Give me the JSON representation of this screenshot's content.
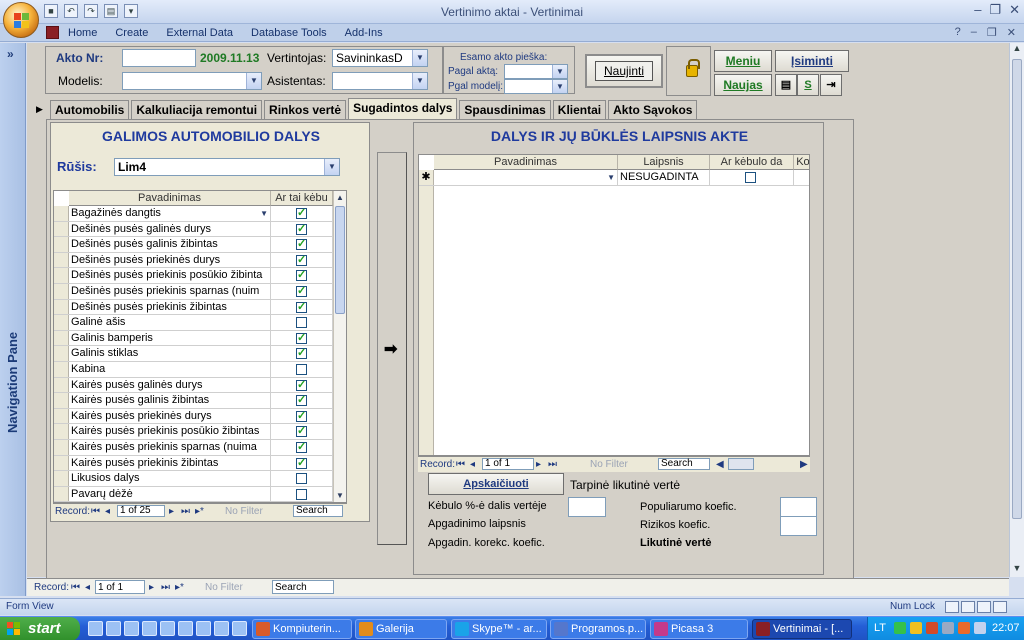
{
  "window": {
    "title": "Vertinimo aktai - Vertinimai",
    "qat_icons": [
      "save-icon",
      "undo-icon",
      "redo-icon",
      "view-icon",
      "customize-icon"
    ]
  },
  "ribbon": {
    "tabs": [
      "Home",
      "Create",
      "External Data",
      "Database Tools",
      "Add-Ins"
    ]
  },
  "nav_pane": {
    "label": "Navigation Pane",
    "toggle": "»"
  },
  "header": {
    "akto_nr_label": "Akto Nr:",
    "akto_nr_value": "",
    "date": "2009.11.13",
    "vertintojas_label": "Vertintojas:",
    "vertintojas_value": "SavininkasD",
    "modelis_label": "Modelis:",
    "modelis_value": "",
    "asistentas_label": "Asistentas:",
    "asistentas_value": ""
  },
  "search_panel": {
    "caption": "Esamo akto pieška:",
    "by_act_label": "Pagal aktą:",
    "by_model_label": "Pgal modelį:"
  },
  "buttons": {
    "refresh": "Naujinti",
    "menu": "Meniu",
    "save": "Įsiminti",
    "new": "Naujas",
    "s_button": "S",
    "calculate": "Apskaičiuoti"
  },
  "tabs": [
    "Automobilis",
    "Kalkuliacija remontui",
    "Rinkos vertė",
    "Sugadintos dalys",
    "Spausdinimas",
    "Klientai",
    "Akto Sąvokos"
  ],
  "active_tab": "Sugadintos dalys",
  "left_panel": {
    "title": "GALIMOS AUTOMOBILIO DALYS",
    "rusis_label": "Rūšis:",
    "rusis_value": "Lim4",
    "columns": [
      "Pavadinimas",
      "Ar tai kėbu"
    ],
    "rows": [
      {
        "name": "Bagažinės dangtis",
        "checked": true
      },
      {
        "name": "Dešinės pusės galinės durys",
        "checked": true
      },
      {
        "name": "Dešinės pusės galinis žibintas",
        "checked": true
      },
      {
        "name": "Dešinės pusės priekinės durys",
        "checked": true
      },
      {
        "name": "Dešinės pusės priekinis posūkio žibinta",
        "checked": true
      },
      {
        "name": "Dešinės pusės priekinis sparnas (nuim",
        "checked": true
      },
      {
        "name": "Dešinės pusės priekinis žibintas",
        "checked": true
      },
      {
        "name": "Galinė ašis",
        "checked": false
      },
      {
        "name": "Galinis bamperis",
        "checked": true
      },
      {
        "name": "Galinis stiklas",
        "checked": true
      },
      {
        "name": "Kabina",
        "checked": false
      },
      {
        "name": "Kairės pusės galinės durys",
        "checked": true
      },
      {
        "name": "Kairės pusės galinis žibintas",
        "checked": true
      },
      {
        "name": "Kairės pusės priekinės durys",
        "checked": true
      },
      {
        "name": "Kairės pusės priekinis posūkio žibintas",
        "checked": true
      },
      {
        "name": "Kairės pusės priekinis sparnas (nuima",
        "checked": true
      },
      {
        "name": "Kairės pusės priekinis žibintas",
        "checked": true
      },
      {
        "name": "Likusios dalys",
        "checked": false
      },
      {
        "name": "Pavarų dėžė",
        "checked": false
      }
    ],
    "record_nav": {
      "label": "Record:",
      "value": "1 of 25",
      "filter": "No Filter",
      "search": "Search"
    }
  },
  "middle_arrow": "➡",
  "right_panel": {
    "title": "DALYS IR JŲ BŪKLĖS LAIPSNIS AKTE",
    "columns": [
      "Pavadinimas",
      "Laipsnis",
      "Ar kėbulo da",
      "Koe"
    ],
    "new_row": {
      "marker": "✱",
      "name": "",
      "laipsnis": "NESUGADINTA",
      "checked": false
    },
    "record_nav": {
      "label": "Record:",
      "value": "1 of 1",
      "filter": "No Filter",
      "search": "Search"
    },
    "calc": {
      "tarpine_label": "Tarpinė likutinė vertė",
      "kebulo_label": "Kėbulo %-ė dalis vertėje",
      "apgadinimo_label": "Apgadinimo laipsnis",
      "korekc_label": "Apgadin. korekc. koefic.",
      "populiarumo_label": "Populiarumo koefic.",
      "rizikos_label": "Rizikos koefic.",
      "likutine_label": "Likutinė vertė"
    }
  },
  "form_record_nav": {
    "label": "Record:",
    "value": "1 of 1",
    "filter": "No Filter",
    "search": "Search"
  },
  "statusbar": {
    "left": "Form View",
    "numlock": "Num Lock"
  },
  "taskbar": {
    "start": "start",
    "tasks": [
      {
        "label": "Kompiuterin...",
        "color": "#d85b2a",
        "active": false
      },
      {
        "label": "Galerija",
        "color": "#e28c1c",
        "active": false
      },
      {
        "label": "Skype™ - ar...",
        "color": "#1aa3e8",
        "active": false
      },
      {
        "label": "Programos.p...",
        "color": "#5577cc",
        "active": false
      },
      {
        "label": "Picasa 3",
        "color": "#c43a8a",
        "active": false
      },
      {
        "label": "Vertinimai - [...",
        "color": "#8a1f24",
        "active": true
      }
    ],
    "lang": "LT",
    "time": "22:07"
  }
}
